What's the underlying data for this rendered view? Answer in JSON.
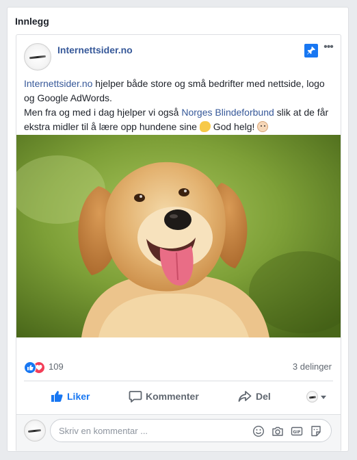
{
  "panel": {
    "title": "Innlegg"
  },
  "post": {
    "page_name": "Internettsider.no",
    "text": {
      "line1_link": "Internettsider.no",
      "line1_rest": " hjelper både store og små bedrifter med nettside, logo og Google AdWords.",
      "line2_start": "Men fra og med i dag hjelper vi også ",
      "line2_link": "Norges Blindeforbund",
      "line2_end": " slik at de får ekstra midler til å lære opp hundene sine ",
      "line2_tail": " God helg! "
    },
    "image_subject": "Golden retriever dog"
  },
  "reactions": {
    "count": "109",
    "shares": "3 delinger"
  },
  "actions": {
    "like": "Liker",
    "comment": "Kommenter",
    "share": "Del"
  },
  "composer": {
    "placeholder": "Skriv en kommentar ..."
  },
  "icons": {
    "pin": "pin-icon",
    "more": "more-options-icon",
    "like": "thumbs-up-icon",
    "comment": "speech-bubble-icon",
    "share": "share-arrow-icon",
    "emoji": "smiley-icon",
    "camera": "camera-icon",
    "gif": "gif-icon",
    "sticker": "sticker-icon"
  },
  "colors": {
    "link": "#365899",
    "accent": "#1877f2",
    "heart": "#f33e58",
    "muted": "#606770"
  }
}
